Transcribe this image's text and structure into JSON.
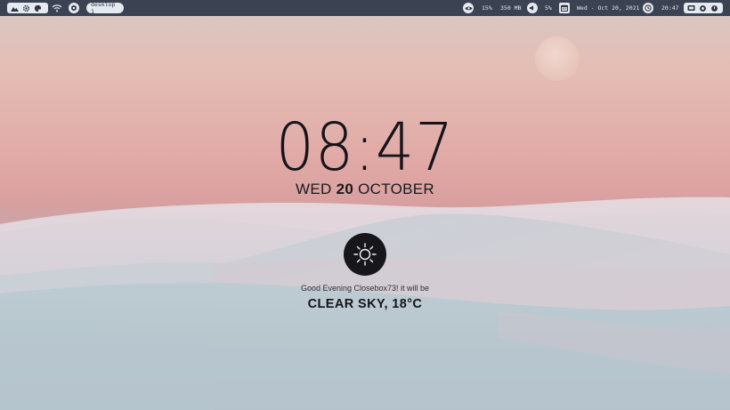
{
  "topbar": {
    "left_icons": [
      "mountain-icon",
      "gear-icon",
      "palette-icon"
    ],
    "wifi_icon": "wifi-icon",
    "record_icon": "record-icon",
    "workspace_label": "desktop 1",
    "cpu_icon": "eye-icon",
    "cpu_value": "15%",
    "memory_value": "350 MB",
    "volume_icon": "volume-icon",
    "volume_value": "5%",
    "calendar_icon": "calendar-icon",
    "date_text": "Wed - Oct 20, 2021",
    "clock_icon": "clock-icon",
    "time_text": "20:47",
    "right_icons": [
      "lock-icon",
      "restart-icon",
      "power-icon"
    ],
    "bar_color": "#3b4252",
    "widget_color": "#e5e9f0"
  },
  "lockscreen": {
    "time": "08:47",
    "weekday": "WED",
    "day": "20",
    "month": "OCTOBER",
    "weather_icon": "sun-icon",
    "greeting": "Good Evening Closebox73! it will be",
    "forecast": "CLEAR SKY, 18°C"
  },
  "wallpaper": {
    "description_colors": [
      "#dac8c4",
      "#e2aaa6",
      "#c9d3d6",
      "#b9c8cd"
    ],
    "moon_icon": "moon-icon"
  }
}
